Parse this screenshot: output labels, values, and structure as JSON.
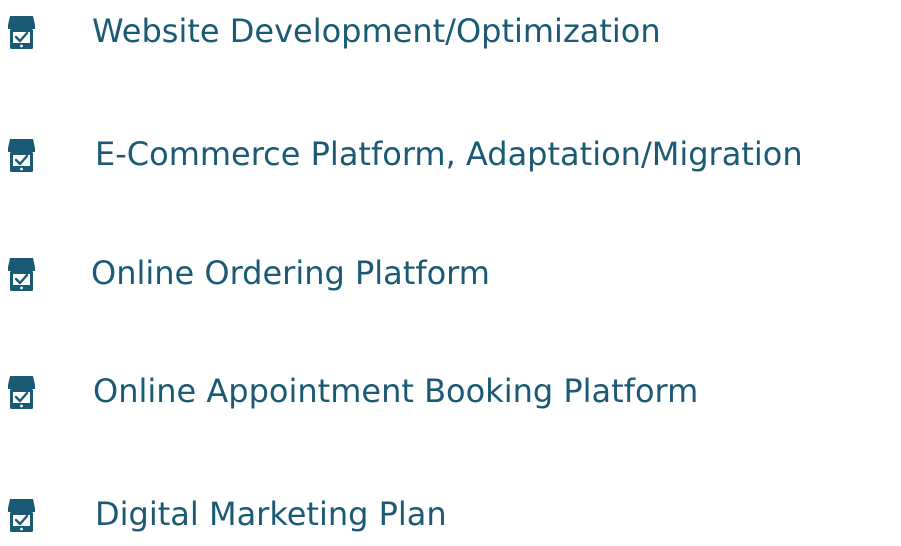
{
  "theme": {
    "text_color": "#1b5a74",
    "icon_color": "#1b5a74",
    "background": "#ffffff"
  },
  "services": [
    {
      "label": "Website Development/Optimization",
      "icon": "storefront-check-icon"
    },
    {
      "label": "E-Commerce Platform, Adaptation/Migration",
      "icon": "storefront-check-icon"
    },
    {
      "label": "Online Ordering Platform",
      "icon": "storefront-check-icon"
    },
    {
      "label": "Online Appointment Booking Platform",
      "icon": "storefront-check-icon"
    },
    {
      "label": "Digital Marketing Plan",
      "icon": "storefront-check-icon"
    }
  ]
}
